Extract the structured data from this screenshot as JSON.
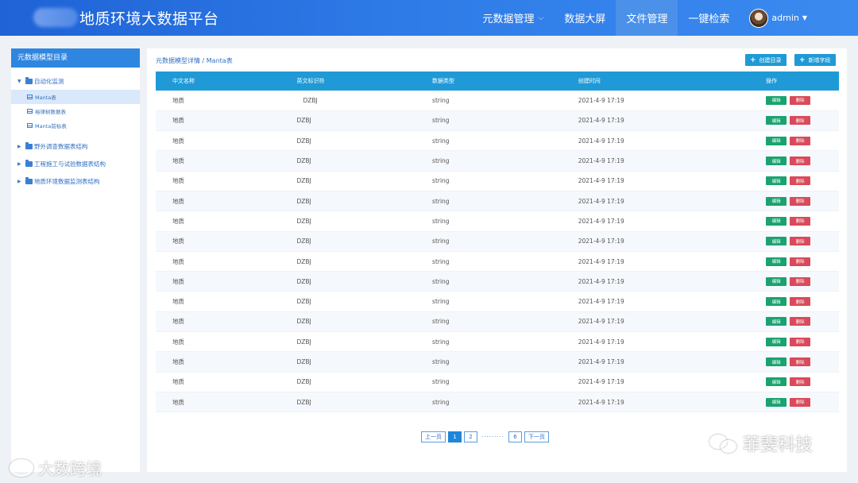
{
  "header": {
    "title": "地质环境大数据平台",
    "nav": [
      {
        "label": "元数据管理",
        "has_caret": true
      },
      {
        "label": "数据大屏"
      },
      {
        "label": "文件管理",
        "active": true
      },
      {
        "label": "一键检索"
      }
    ],
    "user": "admin"
  },
  "sidebar": {
    "title": "元数据模型目录",
    "tree": [
      {
        "label": "自动化监测",
        "expanded": true,
        "children": [
          "Manta表",
          "裕律树数据表",
          "Manta前标表"
        ]
      },
      {
        "label": "野外调查数据表结构"
      },
      {
        "label": "工程施工与试验数据表结构"
      },
      {
        "label": "地质环境数据监测表结构"
      }
    ]
  },
  "main": {
    "breadcrumb": "元数据模型详情 / Manta表",
    "buttons": {
      "create_dir": "创建目录",
      "add_field": "新增字段"
    },
    "columns": [
      "中文名称",
      "英文标识符",
      "数据类型",
      "创建时间",
      "操作"
    ],
    "rows": [
      {
        "cn": "地质",
        "en": "DZBJ",
        "type": "string",
        "time": "2021-4-9  17:19"
      },
      {
        "cn": "地质",
        "en": "DZBJ",
        "type": "string",
        "time": "2021-4-9  17:19"
      },
      {
        "cn": "地质",
        "en": "DZBJ",
        "type": "string",
        "time": "2021-4-9  17:19"
      },
      {
        "cn": "地质",
        "en": "DZBJ",
        "type": "string",
        "time": "2021-4-9  17:19"
      },
      {
        "cn": "地质",
        "en": "DZBJ",
        "type": "string",
        "time": "2021-4-9  17:19"
      },
      {
        "cn": "地质",
        "en": "DZBJ",
        "type": "string",
        "time": "2021-4-9  17:19"
      },
      {
        "cn": "地质",
        "en": "DZBJ",
        "type": "string",
        "time": "2021-4-9  17:19"
      },
      {
        "cn": "地质",
        "en": "DZBJ",
        "type": "string",
        "time": "2021-4-9  17:19"
      },
      {
        "cn": "地质",
        "en": "DZBJ",
        "type": "string",
        "time": "2021-4-9  17:19"
      },
      {
        "cn": "地质",
        "en": "DZBJ",
        "type": "string",
        "time": "2021-4-9  17:19"
      },
      {
        "cn": "地质",
        "en": "DZBJ",
        "type": "string",
        "time": "2021-4-9  17:19"
      },
      {
        "cn": "地质",
        "en": "DZBJ",
        "type": "string",
        "time": "2021-4-9  17:19"
      },
      {
        "cn": "地质",
        "en": "DZBJ",
        "type": "string",
        "time": "2021-4-9  17:19"
      },
      {
        "cn": "地质",
        "en": "DZBJ",
        "type": "string",
        "time": "2021-4-9  17:19"
      },
      {
        "cn": "地质",
        "en": "DZBJ",
        "type": "string",
        "time": "2021-4-9  17:19"
      },
      {
        "cn": "地质",
        "en": "DZBJ",
        "type": "string",
        "time": "2021-4-9  17:19"
      }
    ],
    "row_actions": {
      "edit": "编辑",
      "delete": "删除"
    },
    "pagination": {
      "prev": "上一页",
      "pages": [
        "1",
        "2"
      ],
      "dots": "·········",
      "last": "6",
      "next": "下一页",
      "current": "1"
    }
  },
  "watermarks": {
    "left": "大数跨境",
    "right": "菲斐科技"
  },
  "colors": {
    "header": "#2f7ce8",
    "accent": "#1f9ad7",
    "edit": "#1aa36f",
    "delete": "#d94a5a"
  }
}
